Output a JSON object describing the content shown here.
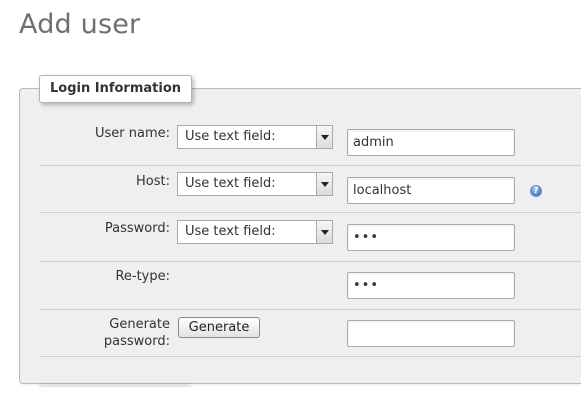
{
  "page": {
    "title": "Add user"
  },
  "login_info": {
    "legend": "Login Information",
    "rows": [
      {
        "label": "User name:",
        "select_value": "Use text field:",
        "input_value": "admin"
      },
      {
        "label": "Host:",
        "select_value": "Use text field:",
        "input_value": "localhost",
        "help_icon": "help-icon"
      },
      {
        "label": "Password:",
        "select_value": "Use text field:",
        "input_value": "•••"
      },
      {
        "label": "Re-type:",
        "input_value": "•••"
      },
      {
        "label_line1": "Generate",
        "label_line2": "password:",
        "button_label": "Generate",
        "input_value": ""
      }
    ]
  },
  "colors": {
    "title": "#6f6f6f",
    "fieldset_bg": "#efefef",
    "help_icon": "#4a7cc0"
  }
}
